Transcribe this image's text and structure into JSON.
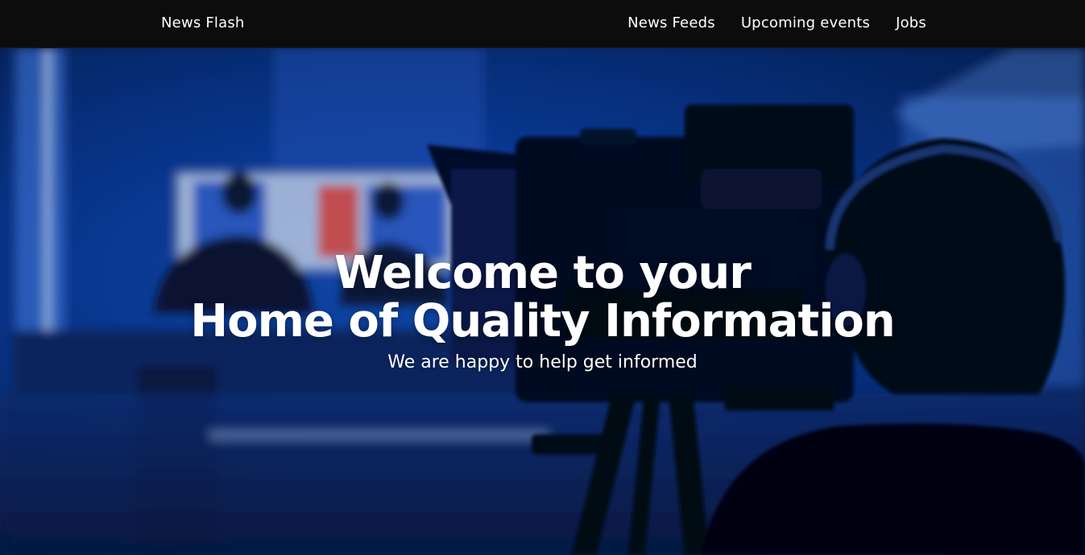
{
  "nav": {
    "brand": "News Flash",
    "links": [
      "News Feeds",
      "Upcoming events",
      "Jobs"
    ]
  },
  "hero": {
    "headline_line1": "Welcome to your",
    "headline_line2": "Home of Quality Information",
    "subtitle": "We are happy to help get informed",
    "background": "news-studio-photo",
    "colors": {
      "nav_bg": "#0c0c0c",
      "studio_blue": "#1f5fd6",
      "text": "#ffffff"
    }
  }
}
